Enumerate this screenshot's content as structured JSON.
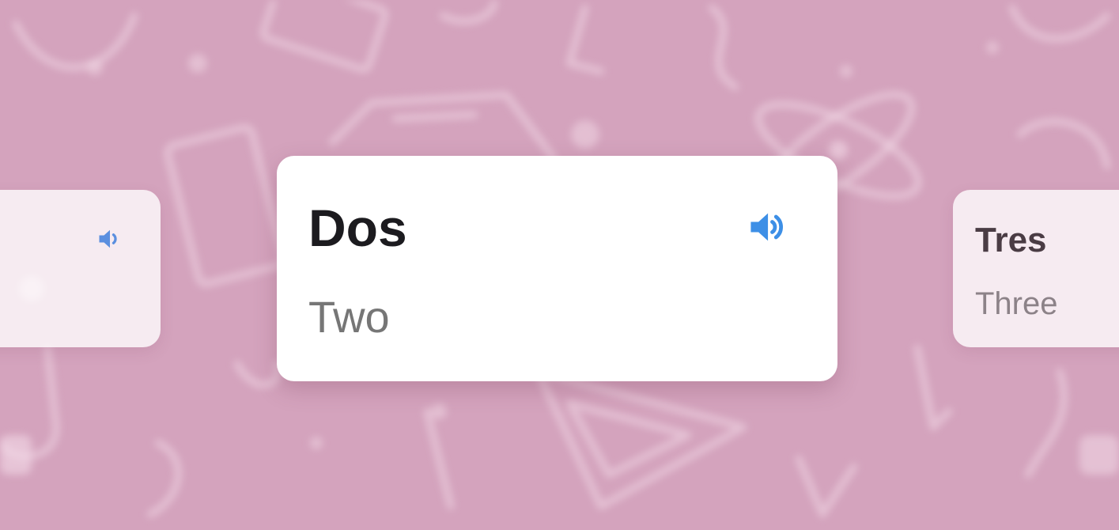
{
  "carousel": {
    "cards": [
      {
        "word": "",
        "translation": "",
        "state": "previous"
      },
      {
        "word": "Dos",
        "translation": "Two",
        "state": "active"
      },
      {
        "word": "Tres",
        "translation": "Three",
        "state": "next"
      }
    ]
  },
  "icons": {
    "speaker": "speaker-icon",
    "background": [
      "science-doodle-icons"
    ]
  },
  "colors": {
    "background": "#d4a3bd",
    "card": "#ffffff",
    "speaker": "#3d8fe6",
    "speaker_muted": "#5b8fdf",
    "word": "#1c1b1f",
    "translation": "#767676"
  }
}
